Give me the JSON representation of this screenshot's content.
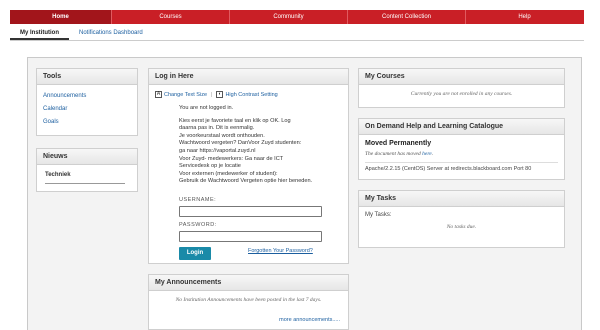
{
  "nav": {
    "tabs": [
      "Home",
      "Courses",
      "Community",
      "Content Collection",
      "Help"
    ],
    "active_index": 0
  },
  "subtabs": [
    "My Institution",
    "Notifications Dashboard"
  ],
  "tools": {
    "title": "Tools",
    "links": [
      "Announcements",
      "Calendar",
      "Goals"
    ]
  },
  "news": {
    "title": "Nieuws",
    "item": "Techniek"
  },
  "login": {
    "title": "Log in Here",
    "change_text_size": "Change Text Size",
    "high_contrast": "High Contrast Setting",
    "lines": [
      "You are not logged in.",
      "",
      "Kies eerst je favoriete taal en klik op OK. Log",
      "daarna pas in. Dit is eenmalig.",
      "Je voorkeurstaal wordt onthouden.",
      "Wachtwoord vergeten? DanVoor Zuyd studenten:",
      "ga naar https://vaportal.zuyd.nl",
      "Voor Zuyd- medewerkers: Ga naar de ICT",
      "Servicedesk op je locatie",
      "Voor externen (medewerker of student):",
      "Gebruik de Wachtwoord Vergeten optie hier beneden."
    ],
    "username_label": "USERNAME:",
    "password_label": "PASSWORD:",
    "login_button": "Login",
    "forgot_link": "Forgotten Your Password?"
  },
  "announcements": {
    "title": "My Announcements",
    "empty": "No Institution Announcements have been posted in the last 7 days.",
    "more": "more announcements....."
  },
  "courses": {
    "title": "My Courses",
    "empty": "Currently you are not enrolled in any courses."
  },
  "ondemand": {
    "title": "On Demand Help and Learning Catalogue",
    "heading": "Moved Permanently",
    "body_prefix": "The document has moved ",
    "body_link": "here",
    "body_suffix": ".",
    "footer": "Apache/2.2.15 (CentOS) Server at redirects.blackboard.com Port 80"
  },
  "tasks": {
    "title": "My Tasks",
    "label": "My Tasks:",
    "empty": "No tasks due."
  },
  "colors": {
    "nav_red": "#c91f26",
    "nav_active": "#a2151b",
    "link_blue": "#1b5e9f",
    "button_teal": "#1a8aa8"
  }
}
